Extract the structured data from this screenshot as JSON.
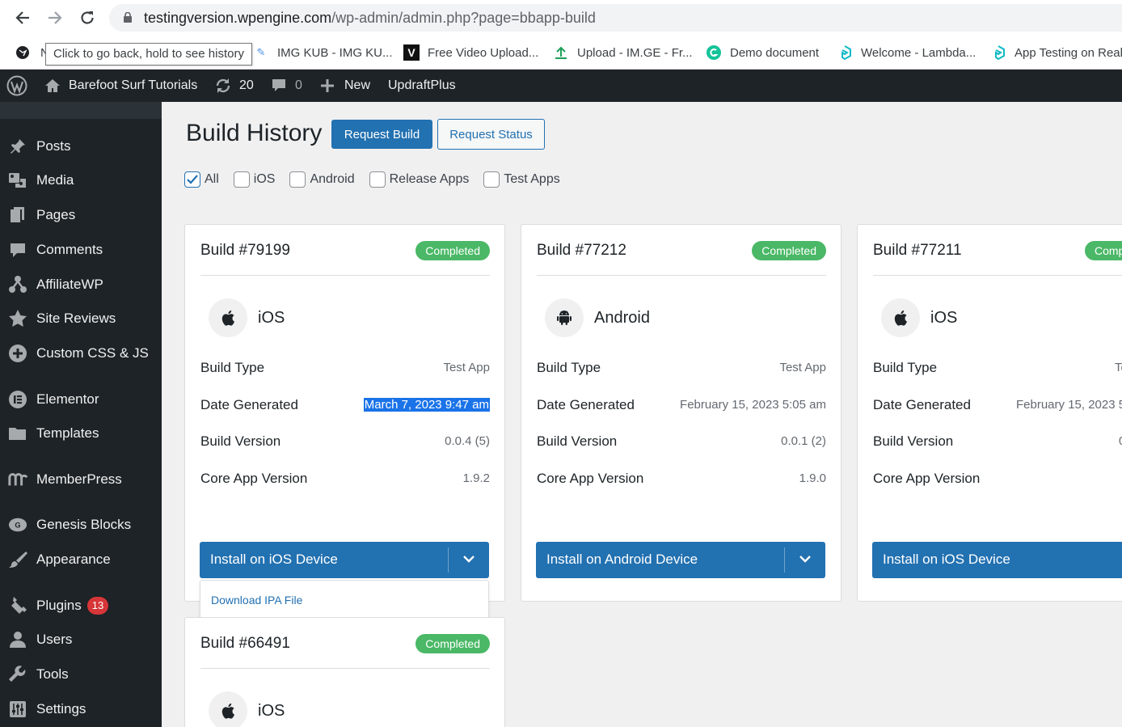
{
  "browser": {
    "url_host": "testingversion.wpengine.com",
    "url_path": "/wp-admin/admin.php?page=bbapp-build",
    "tooltip": "Click to go back, hold to see history",
    "bookmark_first_letter": "N",
    "bookmarks": [
      {
        "label": "IMG KUB - IMG KU...",
        "icon": "img-kub-icon"
      },
      {
        "label": "Free Video Upload...",
        "icon": "vimeo-icon"
      },
      {
        "label": "Upload - IM.GE - Fr...",
        "icon": "upload-icon"
      },
      {
        "label": "Demo document",
        "icon": "grammarly-icon"
      },
      {
        "label": "Welcome - Lambda...",
        "icon": "lambdatest-icon"
      },
      {
        "label": "App Testing on Real...",
        "icon": "lambdatest-icon"
      }
    ]
  },
  "admin_bar": {
    "site_name": "Barefoot Surf Tutorials",
    "updates_count": "20",
    "comments_count": "0",
    "new_label": "New",
    "plugin_label": "UpdraftPlus"
  },
  "sidebar": {
    "items": [
      {
        "label": "Posts",
        "icon": "pin-icon"
      },
      {
        "label": "Media",
        "icon": "media-icon"
      },
      {
        "label": "Pages",
        "icon": "pages-icon"
      },
      {
        "label": "Comments",
        "icon": "comments-icon"
      },
      {
        "label": "AffiliateWP",
        "icon": "affiliate-icon"
      },
      {
        "label": "Site Reviews",
        "icon": "star-icon"
      },
      {
        "label": "Custom CSS & JS",
        "icon": "plus-circle-icon"
      },
      {
        "label": "Elementor",
        "icon": "elementor-icon"
      },
      {
        "label": "Templates",
        "icon": "folder-icon"
      },
      {
        "label": "MemberPress",
        "icon": "memberpress-icon"
      },
      {
        "label": "Genesis Blocks",
        "icon": "genesis-icon"
      },
      {
        "label": "Appearance",
        "icon": "brush-icon"
      },
      {
        "label": "Plugins",
        "icon": "plugin-icon",
        "badge": "13"
      },
      {
        "label": "Users",
        "icon": "user-icon"
      },
      {
        "label": "Tools",
        "icon": "wrench-icon"
      },
      {
        "label": "Settings",
        "icon": "settings-icon"
      }
    ]
  },
  "page": {
    "title": "Build History",
    "request_build": "Request Build",
    "request_status": "Request Status",
    "filters": [
      {
        "label": "All",
        "checked": true
      },
      {
        "label": "iOS",
        "checked": false
      },
      {
        "label": "Android",
        "checked": false
      },
      {
        "label": "Release Apps",
        "checked": false
      },
      {
        "label": "Test Apps",
        "checked": false
      }
    ]
  },
  "labels": {
    "build_type": "Build Type",
    "date_generated": "Date Generated",
    "build_version": "Build Version",
    "core_app_version": "Core App Version"
  },
  "builds": [
    {
      "number": "Build #79199",
      "status": "Completed",
      "platform": "iOS",
      "build_type": "Test App",
      "date_generated": "March 7, 2023 9:47 am",
      "build_version": "0.0.4 (5)",
      "core_app_version": "1.9.2",
      "install_label": "Install on iOS Device"
    },
    {
      "number": "Build #77212",
      "status": "Completed",
      "platform": "Android",
      "build_type": "Test App",
      "date_generated": "February 15, 2023 5:05 am",
      "build_version": "0.0.1 (2)",
      "core_app_version": "1.9.0",
      "install_label": "Install on Android Device"
    },
    {
      "number": "Build #77211",
      "status": "Comp",
      "platform": "iOS",
      "build_type": "Te",
      "date_generated": "February 15, 2023 5",
      "build_version": "0",
      "core_app_version": "",
      "install_label": "Install on iOS Device"
    },
    {
      "number": "Build #66491",
      "status": "Completed",
      "platform": "iOS"
    }
  ],
  "dropdown": {
    "download_label": "Download IPA File"
  },
  "colors": {
    "primary": "#2271b1",
    "status_green": "#4ab866",
    "admin_dark": "#1d2327",
    "badge_red": "#d63638"
  }
}
